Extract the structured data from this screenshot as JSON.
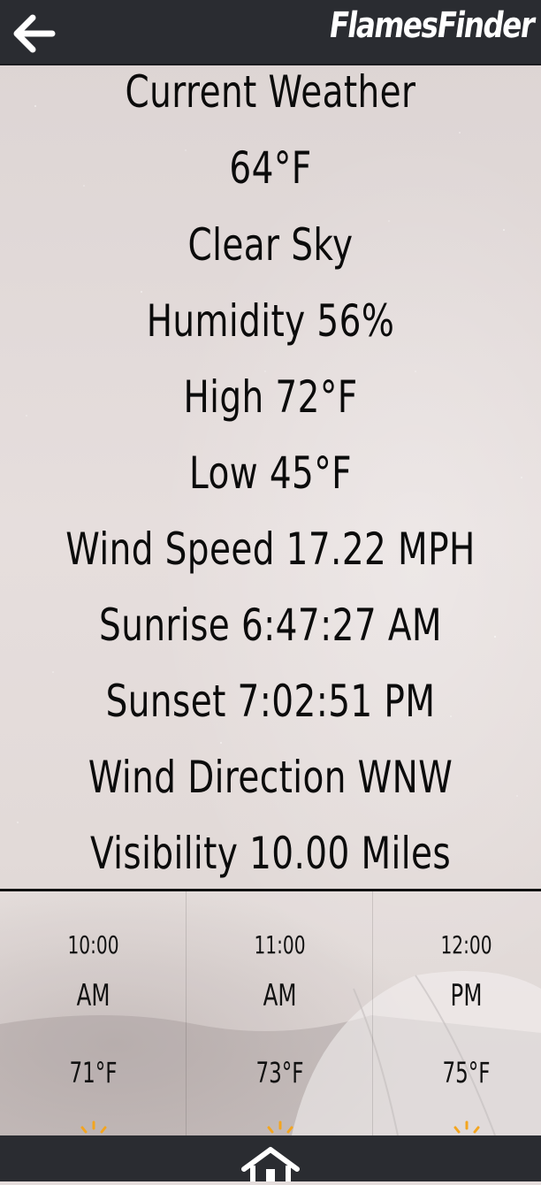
{
  "header": {
    "back_icon": "arrow-left-icon",
    "title": "FlamesFinder"
  },
  "weather": {
    "heading": "Current Weather",
    "temperature": "64°F",
    "condition": "Clear Sky",
    "humidity": "Humidity 56%",
    "high": "High 72°F",
    "low": "Low 45°F",
    "wind_speed": "Wind Speed 17.22 MPH",
    "sunrise": "Sunrise 6:47:27 AM",
    "sunset": "Sunset 7:02:51 PM",
    "wind_direction": "Wind Direction WNW",
    "visibility": "Visibility 10.00 Miles"
  },
  "hourly": [
    {
      "time": "10:00",
      "ampm": "AM",
      "temp": "71°F",
      "icon": "sun-icon"
    },
    {
      "time": "11:00",
      "ampm": "AM",
      "temp": "73°F",
      "icon": "sun-icon"
    },
    {
      "time": "12:00",
      "ampm": "PM",
      "temp": "75°F",
      "icon": "sun-icon"
    }
  ],
  "footer": {
    "home_icon": "home-icon"
  },
  "colors": {
    "bar": "#2a2c31",
    "text": "#0b0b0b",
    "sun": "#f3a51f"
  }
}
